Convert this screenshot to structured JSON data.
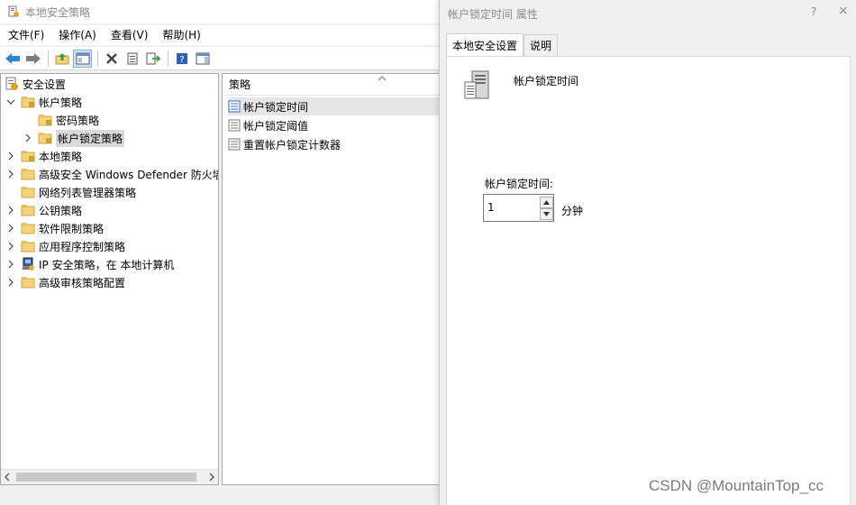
{
  "main_window": {
    "title": "本地安全策略"
  },
  "menu": [
    {
      "label": "文件(F)"
    },
    {
      "label": "操作(A)"
    },
    {
      "label": "查看(V)"
    },
    {
      "label": "帮助(H)"
    }
  ],
  "toolbar": {
    "buttons": [
      "back-arrow-icon",
      "forward-arrow-icon",
      "up-folder-icon",
      "show-tree-icon",
      "delete-icon",
      "properties-icon",
      "export-list-icon",
      "help-icon",
      "action-pane-icon"
    ]
  },
  "tree": {
    "items": [
      {
        "label": "安全设置"
      },
      {
        "label": "帐户策略"
      },
      {
        "label": "密码策略"
      },
      {
        "label": "帐户锁定策略"
      },
      {
        "label": "本地策略"
      },
      {
        "label": "高级安全 Windows Defender 防火墙"
      },
      {
        "label": "网络列表管理器策略"
      },
      {
        "label": "公钥策略"
      },
      {
        "label": "软件限制策略"
      },
      {
        "label": "应用程序控制策略"
      },
      {
        "label": "IP 安全策略，在 本地计算机"
      },
      {
        "label": "高级审核策略配置"
      }
    ]
  },
  "policy_list": {
    "header": "策略",
    "rows": [
      {
        "label": "帐户锁定时间"
      },
      {
        "label": "帐户锁定阈值"
      },
      {
        "label": "重置帐户锁定计数器"
      }
    ]
  },
  "dialog": {
    "title": "帐户锁定时间 属性",
    "help": "?",
    "close": "×",
    "tabs": [
      {
        "label": "本地安全设置"
      },
      {
        "label": "说明"
      }
    ],
    "policy_name": "帐户锁定时间",
    "field_label": "帐户锁定时间:",
    "value": "1",
    "unit": "分钟"
  },
  "watermark": "CSDN @MountainTop_cc",
  "colors": {
    "selection": "#d9d9d9",
    "folder": "#f4d37a",
    "title_gray": "#8a8a8a"
  }
}
